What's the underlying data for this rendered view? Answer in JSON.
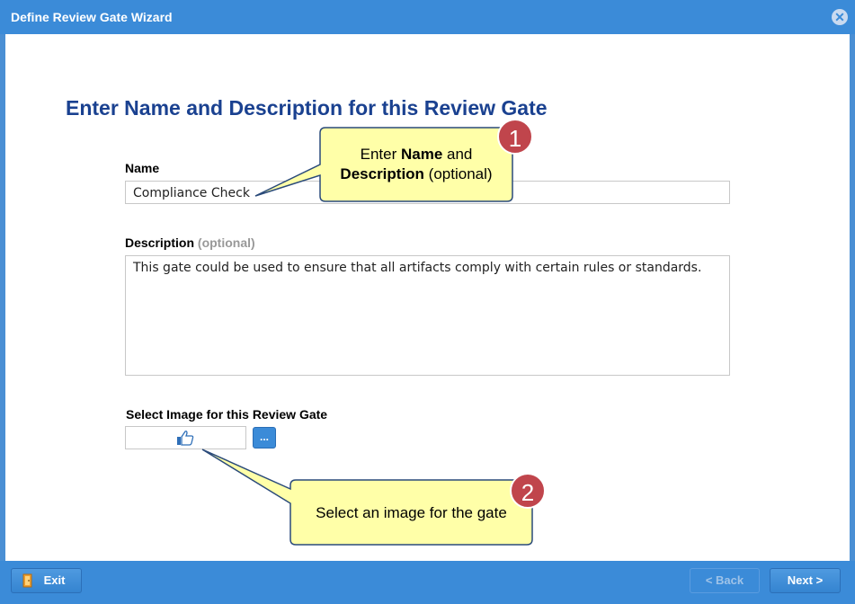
{
  "window": {
    "title": "Define Review Gate Wizard",
    "close_glyph": "✕"
  },
  "main": {
    "heading": "Enter Name and Description for this Review Gate",
    "name_label": "Name",
    "name_value": "Compliance Check",
    "description_label": "Description",
    "description_optional": "(optional)",
    "description_value": "This gate could be used to ensure that all artifacts comply with certain rules or standards.",
    "image_label": "Select Image for this Review Gate",
    "image_icon": "thumbs-up-icon",
    "browse_label": "..."
  },
  "callouts": {
    "one": {
      "badge": "1",
      "line1_prefix": "Enter ",
      "line1_bold": "Name",
      "line1_suffix": " and",
      "line2_bold": "Description",
      "line2_suffix": " (optional)"
    },
    "two": {
      "badge": "2",
      "text": "Select an image for the gate"
    }
  },
  "footer": {
    "exit_label": "Exit",
    "back_label": "< Back",
    "next_label": "Next >"
  },
  "colors": {
    "accent": "#3b8bd8",
    "heading": "#1a4190",
    "callout_fill": "#ffffa8",
    "callout_border": "#2a4a7a",
    "badge": "#c0454c"
  }
}
